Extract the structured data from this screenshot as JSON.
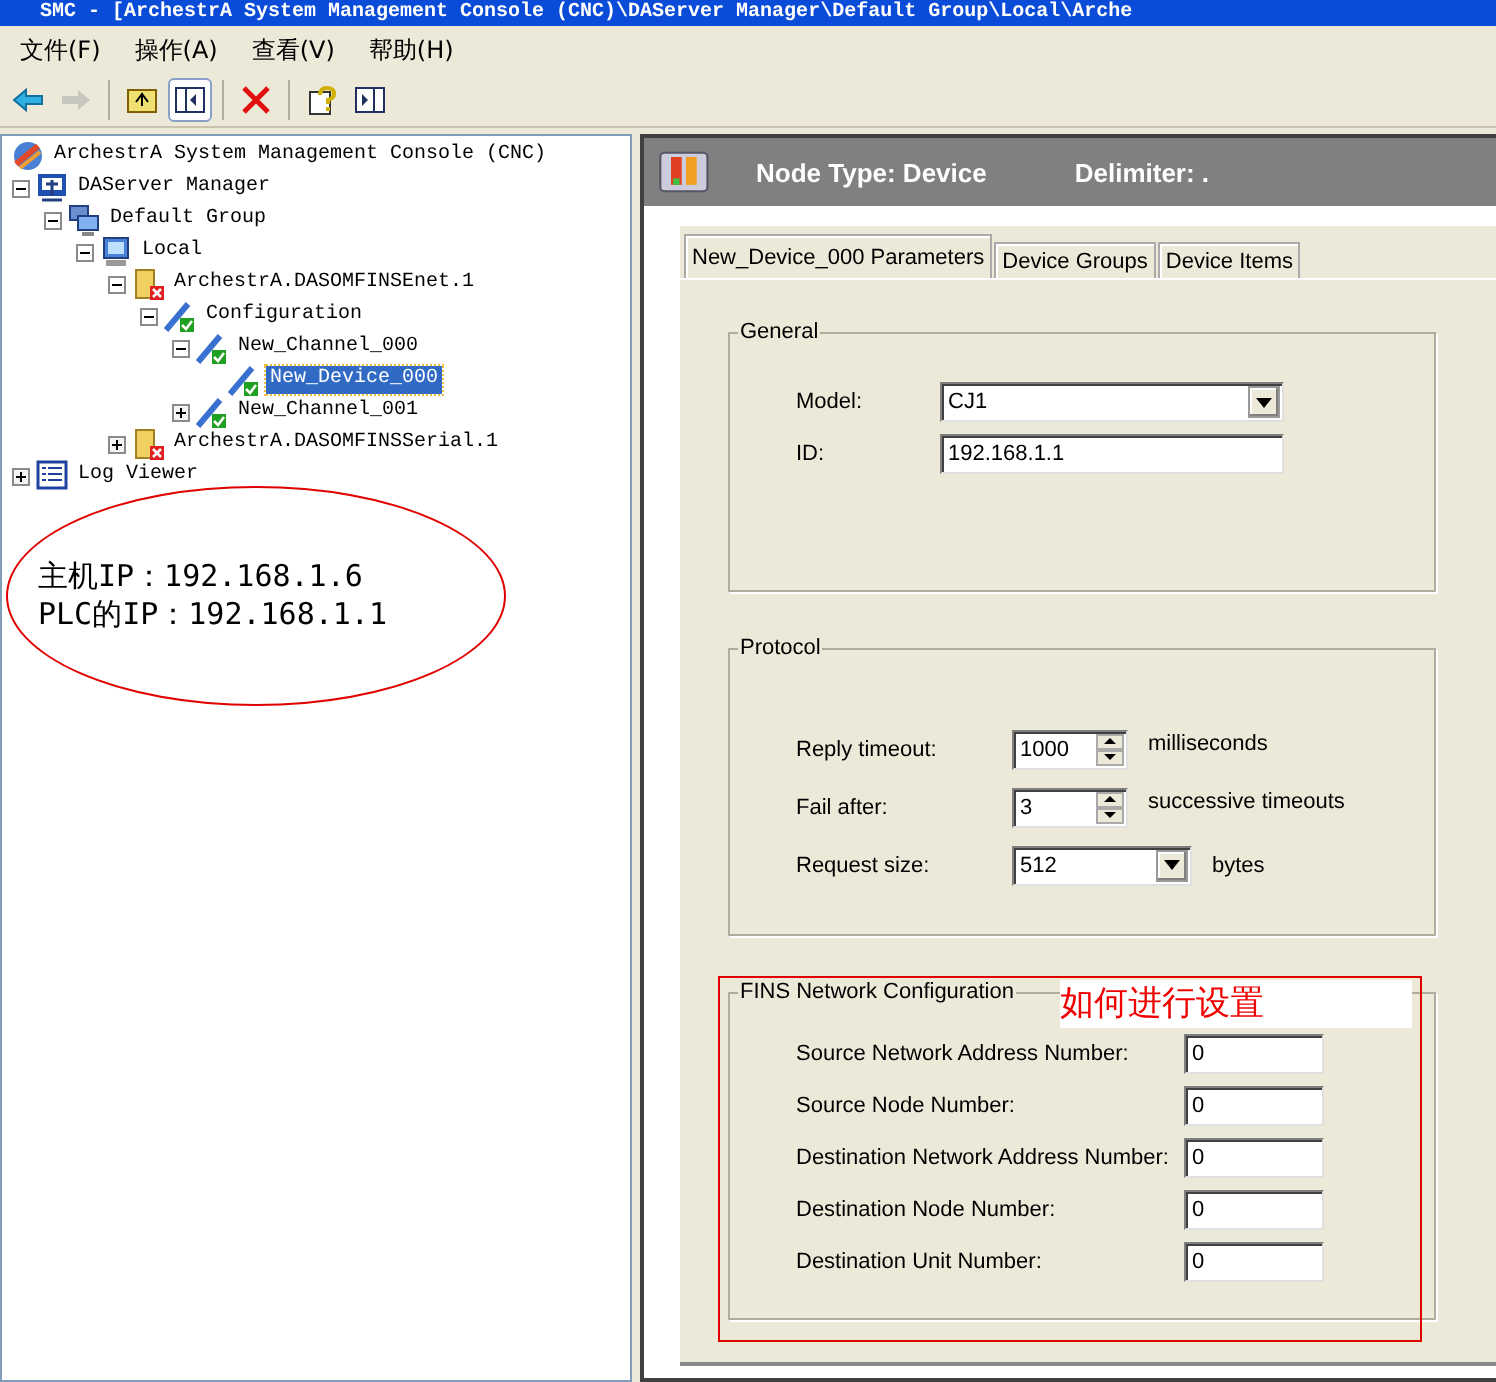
{
  "window": {
    "title": "SMC - [ArchestrA System Management Console (CNC)\\DAServer Manager\\Default Group\\Local\\Arche"
  },
  "menu": [
    {
      "label": "文件(F)"
    },
    {
      "label": "操作(A)"
    },
    {
      "label": "查看(V)"
    },
    {
      "label": "帮助(H)"
    }
  ],
  "toolbar": [
    {
      "kind": "back",
      "disabled": false,
      "pressed": false
    },
    {
      "kind": "forward",
      "disabled": true,
      "pressed": false
    },
    {
      "kind": "sep"
    },
    {
      "kind": "up",
      "disabled": false,
      "pressed": false
    },
    {
      "kind": "tree",
      "disabled": false,
      "pressed": true
    },
    {
      "kind": "sep"
    },
    {
      "kind": "delete",
      "disabled": false,
      "pressed": false
    },
    {
      "kind": "sep"
    },
    {
      "kind": "help",
      "disabled": false,
      "pressed": false
    },
    {
      "kind": "panel",
      "disabled": false,
      "pressed": false
    }
  ],
  "tree": [
    {
      "label": "ArchestrA System Management Console (CNC)",
      "kind": "console",
      "selected": false,
      "children": [
        {
          "label": "DAServer Manager",
          "kind": "manager",
          "expanded": true,
          "selected": false,
          "children": [
            {
              "label": "Default Group",
              "kind": "group",
              "expanded": true,
              "selected": false,
              "children": [
                {
                  "label": "Local",
                  "kind": "computer",
                  "expanded": true,
                  "selected": false,
                  "children": [
                    {
                      "label": "ArchestrA.DASOMFINSEnet.1",
                      "kind": "server",
                      "expanded": true,
                      "selected": false,
                      "children": [
                        {
                          "label": "Configuration",
                          "kind": "config",
                          "expanded": true,
                          "selected": false,
                          "children": [
                            {
                              "label": "New_Channel_000",
                              "kind": "config",
                              "expanded": true,
                              "selected": false,
                              "children": [
                                {
                                  "label": "New_Device_000",
                                  "kind": "config",
                                  "selected": true
                                }
                              ]
                            },
                            {
                              "label": "New_Channel_001",
                              "kind": "config",
                              "expanded": false,
                              "selected": false
                            }
                          ]
                        }
                      ]
                    },
                    {
                      "label": "ArchestrA.DASOMFINSSerial.1",
                      "kind": "server",
                      "expanded": false,
                      "selected": false
                    }
                  ]
                }
              ]
            }
          ]
        },
        {
          "label": "Log Viewer",
          "kind": "log",
          "expanded": false,
          "selected": false
        }
      ]
    }
  ],
  "note": {
    "lines": [
      "主机IP：192.168.1.6",
      "PLC的IP：192.168.1.1"
    ]
  },
  "details": {
    "node_type": "Node Type: Device",
    "delimiter": "Delimiter: .",
    "tabs": [
      {
        "label": "New_Device_000 Parameters",
        "selected": true
      },
      {
        "label": "Device Groups",
        "selected": false
      },
      {
        "label": "Device Items",
        "selected": false
      }
    ],
    "general": {
      "title": "General",
      "fields": [
        {
          "label": "Model:",
          "value": "CJ1",
          "kind": "dropdown"
        },
        {
          "label": "ID:",
          "value": "192.168.1.1",
          "kind": "text"
        }
      ]
    },
    "protocol": {
      "title": "Protocol",
      "fields": [
        {
          "label": "Reply timeout:",
          "value": "1000",
          "kind": "spin",
          "unit": "milliseconds"
        },
        {
          "label": "Fail after:",
          "value": "3",
          "kind": "spin",
          "unit": "successive timeouts"
        },
        {
          "label": "Request size:",
          "value": "512",
          "kind": "dropdown",
          "unit": "bytes"
        }
      ]
    },
    "fins": {
      "title": "FINS Network Configuration",
      "annotation": "如何进行设置",
      "fields": [
        {
          "label": "Source Network Address Number:",
          "value": "0"
        },
        {
          "label": "Source Node Number:",
          "value": "0"
        },
        {
          "label": "Destination Network Address Number:",
          "value": "0"
        },
        {
          "label": "Destination Node Number:",
          "value": "0"
        },
        {
          "label": "Destination Unit Number:",
          "value": "0"
        }
      ]
    }
  }
}
